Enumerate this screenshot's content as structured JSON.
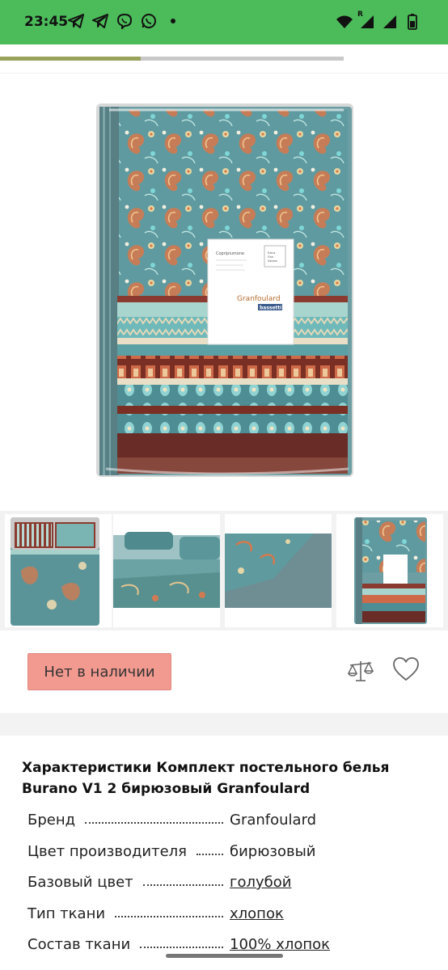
{
  "status_bar": {
    "time": "23:45",
    "left_icons": [
      "telegram-icon",
      "telegram-icon",
      "viber-icon",
      "whatsapp-icon",
      "dot-icon"
    ],
    "right_icons": [
      "wifi-icon",
      "signal-roaming-icon",
      "signal-icon",
      "battery-icon"
    ],
    "roaming_label": "R",
    "color": "#4cbb5a"
  },
  "gallery": {
    "progress": 0.41,
    "thumbnails": [
      "thumbnail-bedroom",
      "thumbnail-pillows",
      "thumbnail-duvet-corner",
      "thumbnail-package"
    ]
  },
  "product_image": {
    "label_brand": "Granfoulard",
    "label_sub": "bassetti",
    "label_name": "Copripiumone",
    "label_badge": "Extra\nFine\nSateen"
  },
  "actions": {
    "out_of_stock_label": "Нет в наличии",
    "out_of_stock_color": "#f39a90",
    "compare_icon": "scales-icon",
    "favorite_icon": "heart-icon"
  },
  "specs": {
    "title": "Характеристики Комплект постельного белья Burano V1 2 бирюзовый Granfoulard",
    "rows": [
      {
        "label": "Бренд",
        "value": "Granfoulard",
        "link": false
      },
      {
        "label": "Цвет производителя",
        "value": "бирюзовый",
        "link": false
      },
      {
        "label": "Базовый цвет",
        "value": "голубой",
        "link": true
      },
      {
        "label": "Тип ткани",
        "value": "хлопок",
        "link": true
      },
      {
        "label": "Состав ткани",
        "value": "100% хлопок",
        "link": true
      }
    ]
  }
}
